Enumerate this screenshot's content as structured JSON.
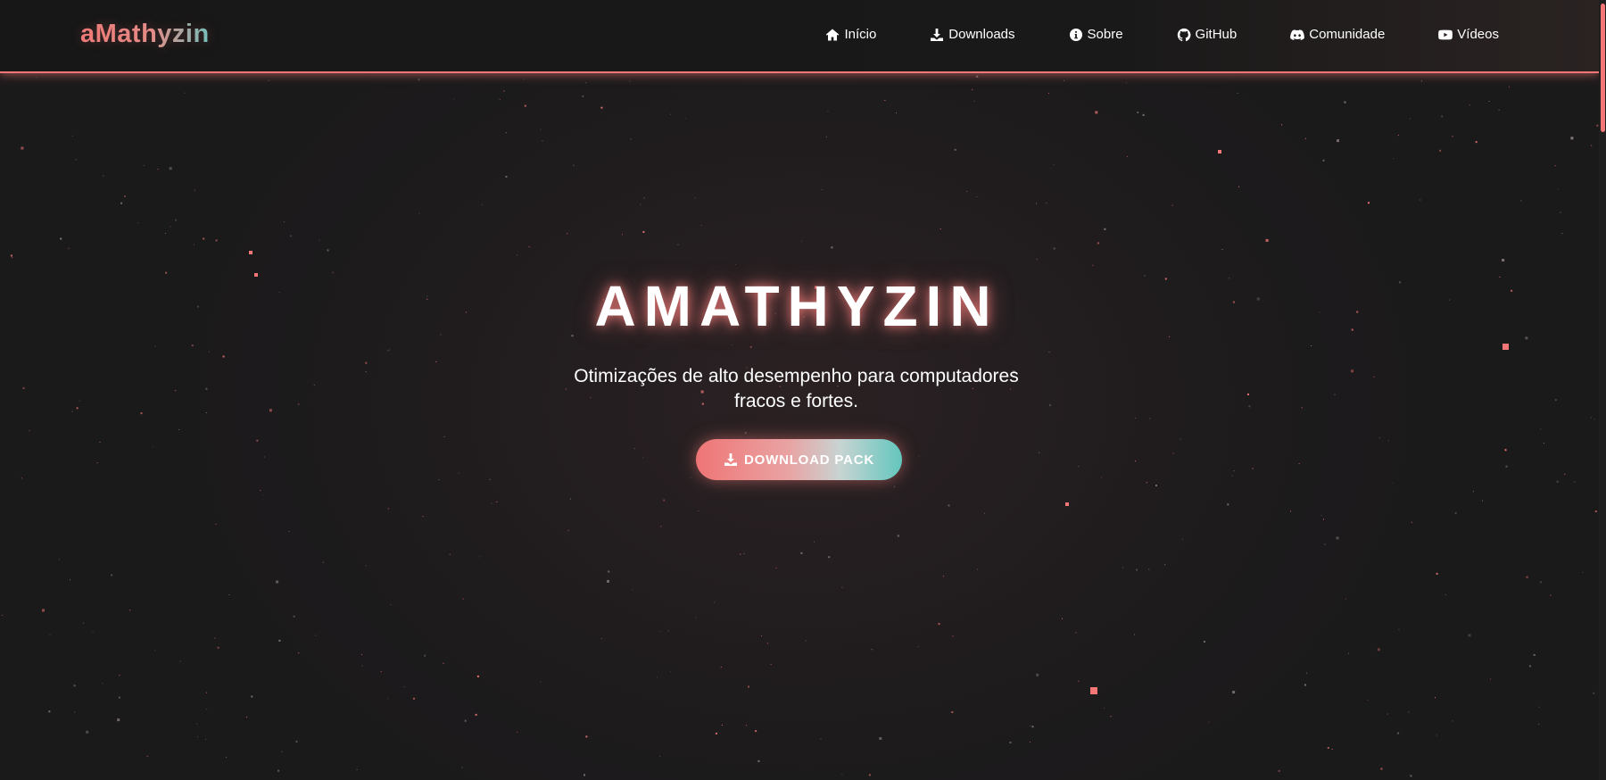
{
  "navbar": {
    "logo": "aMathyzin",
    "items": [
      {
        "label": "Início",
        "icon": "home-icon"
      },
      {
        "label": "Downloads",
        "icon": "download-icon"
      },
      {
        "label": "Sobre",
        "icon": "info-icon"
      },
      {
        "label": "GitHub",
        "icon": "github-icon"
      },
      {
        "label": "Comunidade",
        "icon": "discord-icon"
      },
      {
        "label": "Vídeos",
        "icon": "youtube-icon"
      }
    ]
  },
  "hero": {
    "title": "AMATHYZIN",
    "subtitle": "Otimizações de alto desempenho para computadores fracos e fortes.",
    "cta_label": "DOWNLOAD PACK",
    "cta_icon": "download-icon"
  },
  "colors": {
    "accent": "#f37777",
    "accent_secondary": "#63c6be",
    "background": "#1c1a1b",
    "text": "#ffffff"
  }
}
